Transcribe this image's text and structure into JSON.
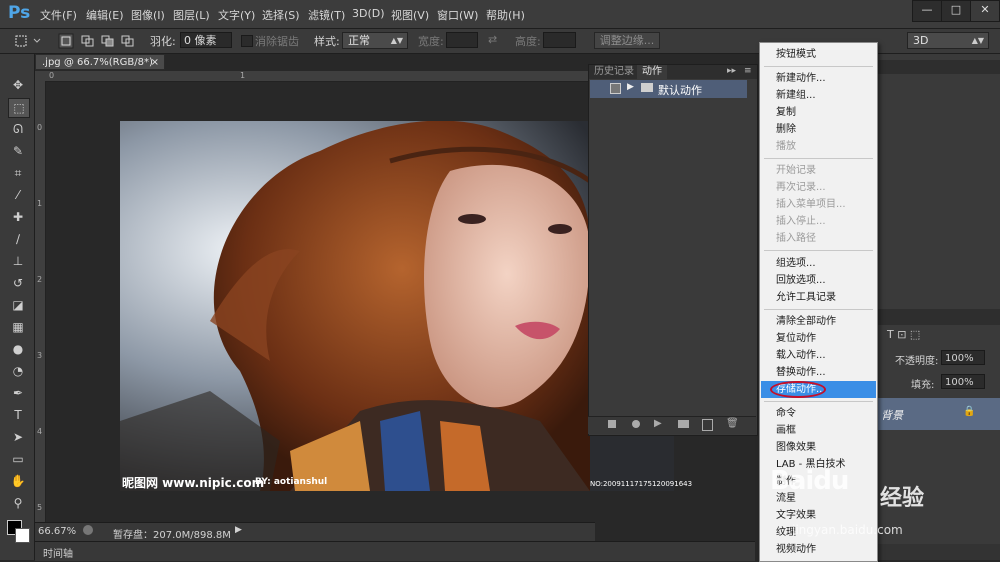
{
  "app": {
    "logo": "Ps"
  },
  "menu": [
    "文件(F)",
    "编辑(E)",
    "图像(I)",
    "图层(L)",
    "文字(Y)",
    "选择(S)",
    "滤镜(T)",
    "3D(D)",
    "视图(V)",
    "窗口(W)",
    "帮助(H)"
  ],
  "window_controls": {
    "minimize": "—",
    "restore": "□",
    "close": "✕"
  },
  "options": {
    "feather_label": "羽化:",
    "feather_value": "0 像素",
    "antialias_label": "消除锯齿",
    "style_label": "样式:",
    "style_value": "正常",
    "width_label": "宽度:",
    "height_label": "高度:",
    "refine_edge": "调整边缘...",
    "workspace": "3D"
  },
  "document": {
    "tab_title": ".jpg @ 66.7%(RGB/8*)",
    "close": "×",
    "zoom": "66.67%",
    "scratch": "暂存盘：207.0M/898.8M",
    "timeline": "时间轴"
  },
  "ruler": {
    "top": [
      "0",
      "1"
    ],
    "left": [
      "0",
      "1",
      "2",
      "3",
      "4",
      "5"
    ]
  },
  "photo": {
    "watermark_site": "昵图网 www.nipic.com",
    "watermark_author": "BY: aotianshul",
    "watermark_id": "NO:20091117175120091643"
  },
  "actions_panel": {
    "tabs": [
      "历史记录",
      "动作"
    ],
    "set_name": "默认动作"
  },
  "right_panel": {
    "opacity_label": "不透明度:",
    "opacity_value": "100%",
    "fill_label": "填充:",
    "fill_value": "100%",
    "layer_name": "背景"
  },
  "context_menu": {
    "items": [
      {
        "label": "按钮模式",
        "enabled": true
      },
      {
        "label": "新建动作...",
        "enabled": true
      },
      {
        "label": "新建组...",
        "enabled": true
      },
      {
        "label": "复制",
        "enabled": true
      },
      {
        "label": "删除",
        "enabled": true
      },
      {
        "label": "播放",
        "enabled": false
      },
      {
        "label": "开始记录",
        "enabled": false
      },
      {
        "label": "再次记录...",
        "enabled": false
      },
      {
        "label": "插入菜单项目...",
        "enabled": false
      },
      {
        "label": "插入停止...",
        "enabled": false
      },
      {
        "label": "插入路径",
        "enabled": false
      },
      {
        "label": "组选项...",
        "enabled": true
      },
      {
        "label": "回放选项...",
        "enabled": true
      },
      {
        "label": "允许工具记录",
        "enabled": true
      },
      {
        "label": "清除全部动作",
        "enabled": true
      },
      {
        "label": "复位动作",
        "enabled": true
      },
      {
        "label": "载入动作...",
        "enabled": true
      },
      {
        "label": "替换动作...",
        "enabled": true
      },
      {
        "label": "存储动作...",
        "enabled": true,
        "highlighted": true
      },
      {
        "label": "命令",
        "enabled": true
      },
      {
        "label": "画框",
        "enabled": true
      },
      {
        "label": "图像效果",
        "enabled": true
      },
      {
        "label": "LAB - 黑白技术",
        "enabled": true
      },
      {
        "label": "制作",
        "enabled": true
      },
      {
        "label": "流星",
        "enabled": true
      },
      {
        "label": "文字效果",
        "enabled": true
      },
      {
        "label": "纹理",
        "enabled": true
      },
      {
        "label": "视频动作",
        "enabled": true
      }
    ]
  },
  "overlay_watermark": {
    "main": "Baidu",
    "cn": "经验",
    "url": "jingyan.baidu.com"
  },
  "colors": {
    "accent": "#3a8ee6",
    "highlight_circle": "#c4102a",
    "ps_logo": "#4fa6e8",
    "selected_row": "#4f5e78"
  }
}
